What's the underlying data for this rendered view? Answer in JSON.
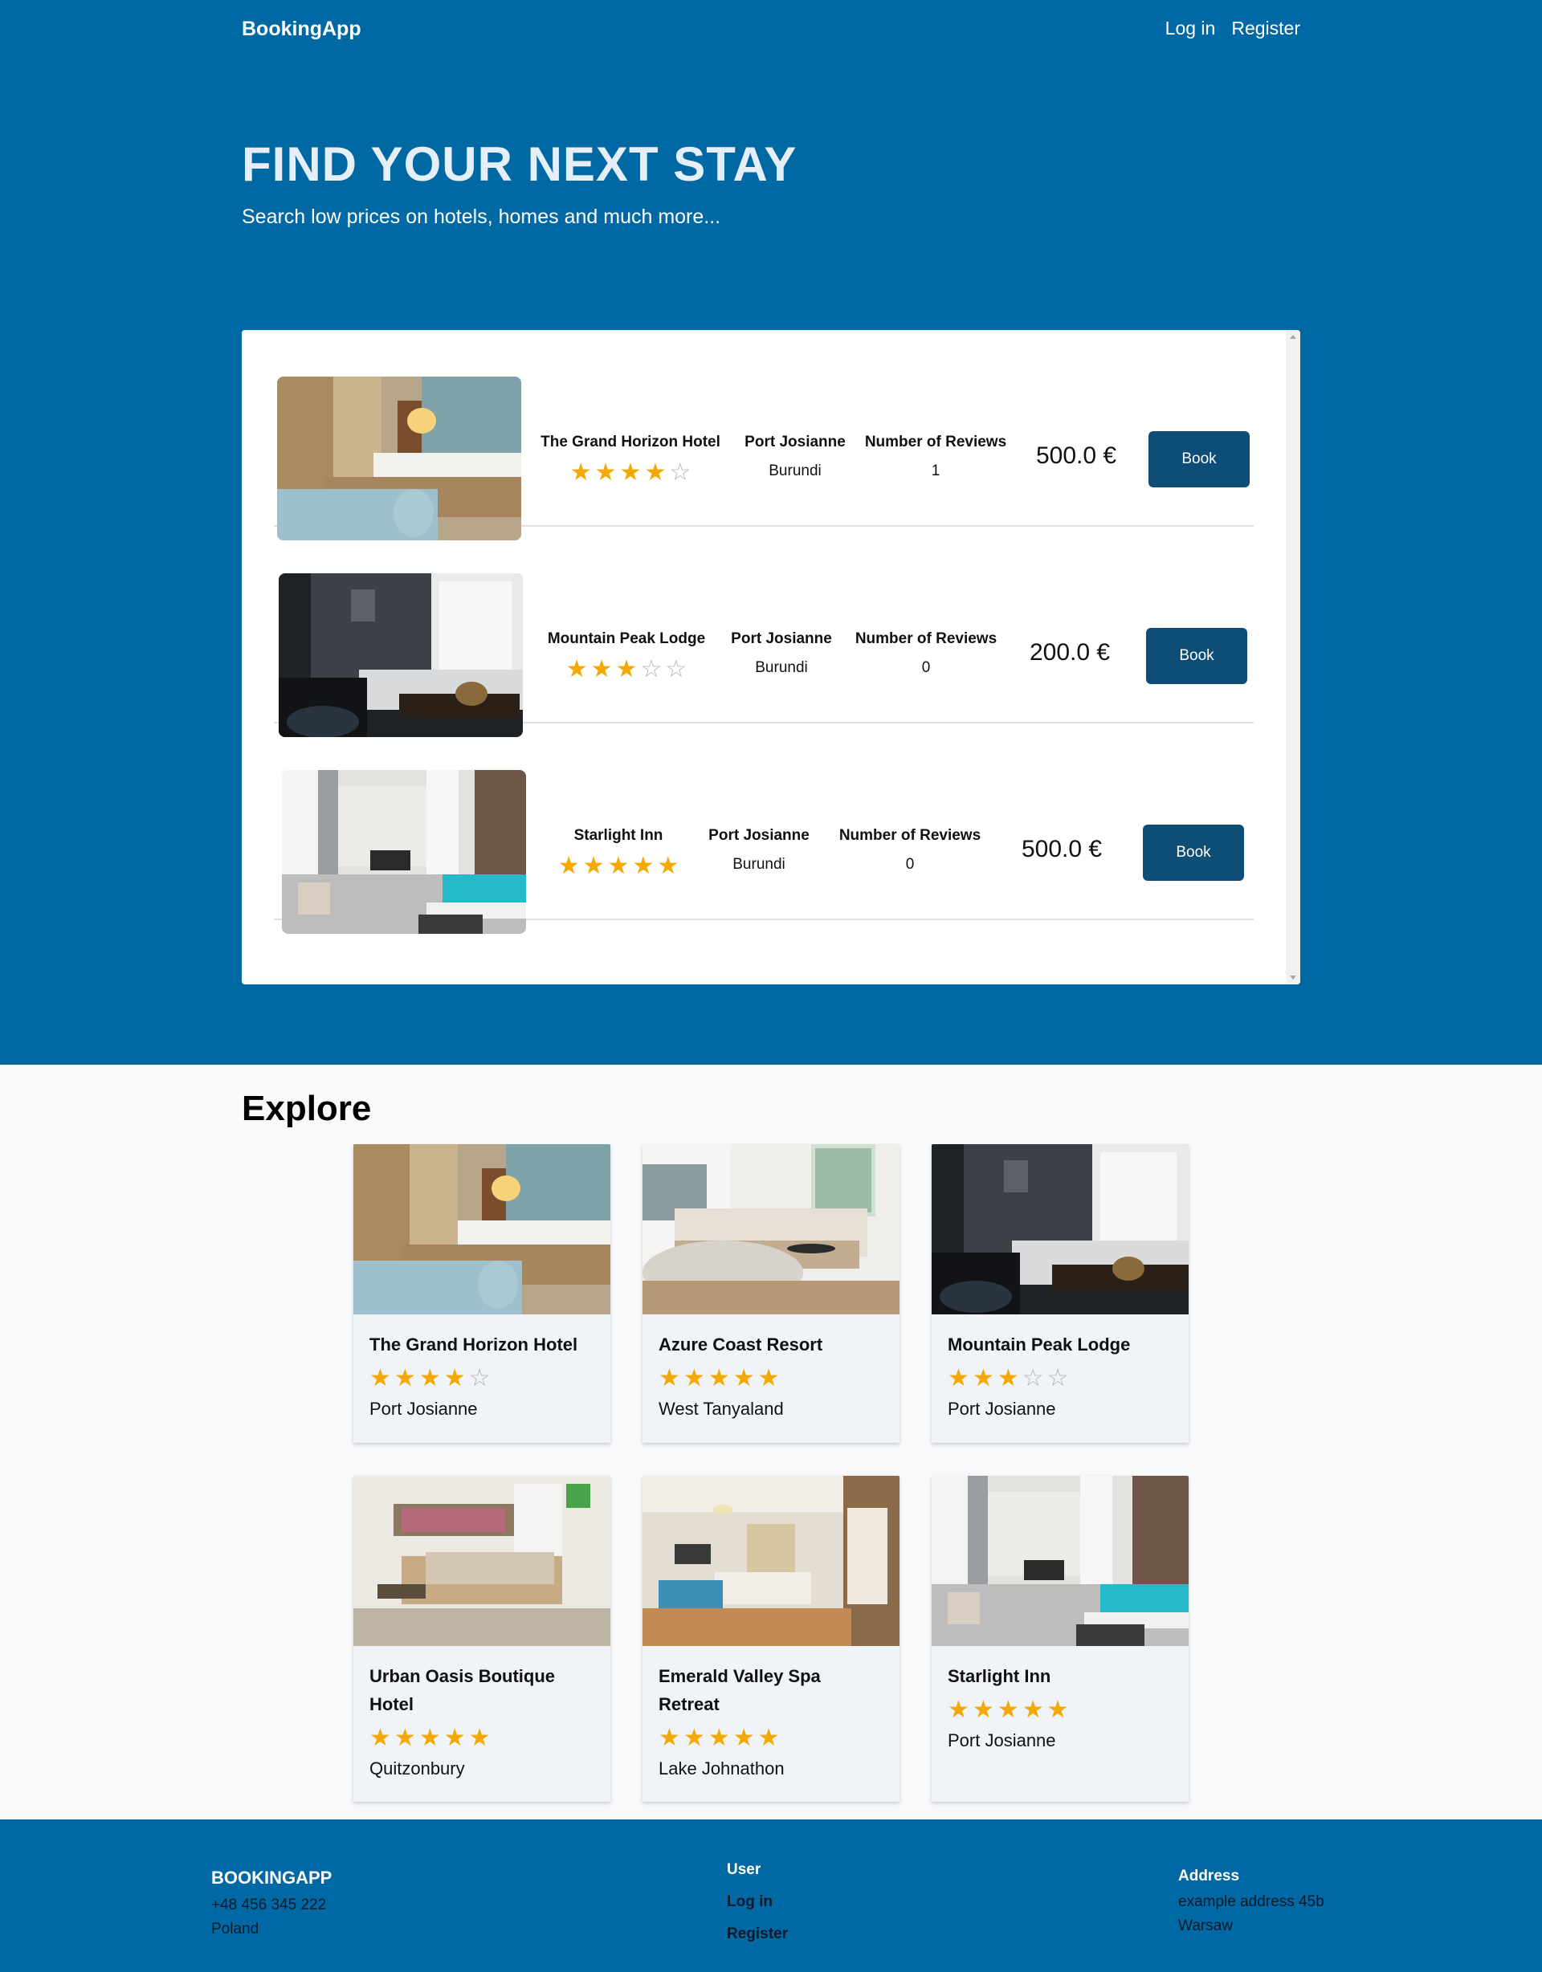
{
  "header": {
    "brand": "BookingApp",
    "login": "Log in",
    "register": "Register"
  },
  "hero": {
    "title": "FIND YOUR NEXT STAY",
    "subtitle": "Search low prices on hotels, homes and much more..."
  },
  "results": [
    {
      "name": "The Grand Horizon Hotel",
      "rating": 4,
      "city": "Port Josianne",
      "country": "Burundi",
      "reviews_label": "Number of Reviews",
      "reviews": "1",
      "price": "500.0 €",
      "book": "Book"
    },
    {
      "name": "Mountain Peak Lodge",
      "rating": 3,
      "city": "Port Josianne",
      "country": "Burundi",
      "reviews_label": "Number of Reviews",
      "reviews": "0",
      "price": "200.0 €",
      "book": "Book"
    },
    {
      "name": "Starlight Inn",
      "rating": 5,
      "city": "Port Josianne",
      "country": "Burundi",
      "reviews_label": "Number of Reviews",
      "reviews": "0",
      "price": "500.0 €",
      "book": "Book"
    }
  ],
  "explore": {
    "title": "Explore",
    "cards": [
      {
        "name": "The Grand Horizon Hotel",
        "rating": 4,
        "city": "Port Josianne"
      },
      {
        "name": "Azure Coast Resort",
        "rating": 5,
        "city": "West Tanyaland"
      },
      {
        "name": "Mountain Peak Lodge",
        "rating": 3,
        "city": "Port Josianne"
      },
      {
        "name": "Urban Oasis Boutique Hotel",
        "rating": 5,
        "city": "Quitzonbury"
      },
      {
        "name": "Emerald Valley Spa Retreat",
        "rating": 5,
        "city": "Lake Johnathon"
      },
      {
        "name": "Starlight Inn",
        "rating": 5,
        "city": "Port Josianne"
      }
    ]
  },
  "footer": {
    "brand": "BOOKINGAPP",
    "phone": "+48 456 345 222",
    "country": "Poland",
    "user_heading": "User",
    "login": "Log in",
    "register": "Register",
    "address_heading": "Address",
    "address_line": "example address 45b",
    "city": "Warsaw"
  },
  "colors": {
    "primary": "#0069a4",
    "button": "#0e4d75",
    "star": "#f5a800"
  }
}
